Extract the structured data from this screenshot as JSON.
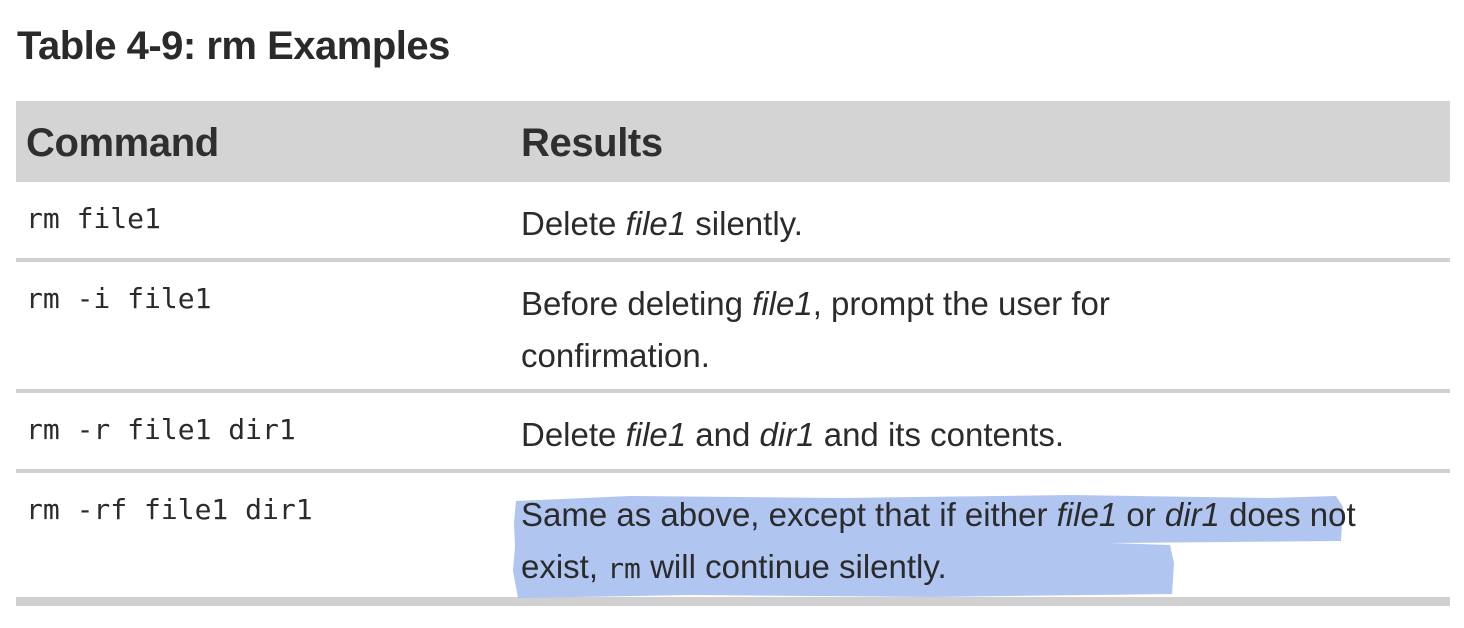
{
  "title": "Table 4-9: rm Examples",
  "table": {
    "headers": {
      "command": "Command",
      "results": "Results"
    },
    "rows": [
      {
        "command": "rm file1",
        "result": {
          "p1": "Delete ",
          "em1": "file1",
          "p2": " silently."
        }
      },
      {
        "command": "rm -i file1",
        "result": {
          "p1": "Before deleting ",
          "em1": "file1",
          "p2": ", prompt the user for confirmation."
        }
      },
      {
        "command": "rm -r file1 dir1",
        "result": {
          "p1": "Delete ",
          "em1": "file1",
          "p2": " and ",
          "em2": "dir1",
          "p3": " and its contents."
        }
      },
      {
        "command": "rm -rf file1 dir1",
        "result": {
          "p1": "Same as above, except that if either ",
          "em1": "file1",
          "p2": " or ",
          "em2": "dir1",
          "p3": " does not exist, ",
          "code1": "rm",
          "p4": " will continue silently."
        }
      }
    ]
  },
  "colors": {
    "header_bg": "#d4d4d4",
    "rule": "#d0d0d0",
    "highlight": "#a8bff0",
    "text": "#2b2b2b"
  }
}
